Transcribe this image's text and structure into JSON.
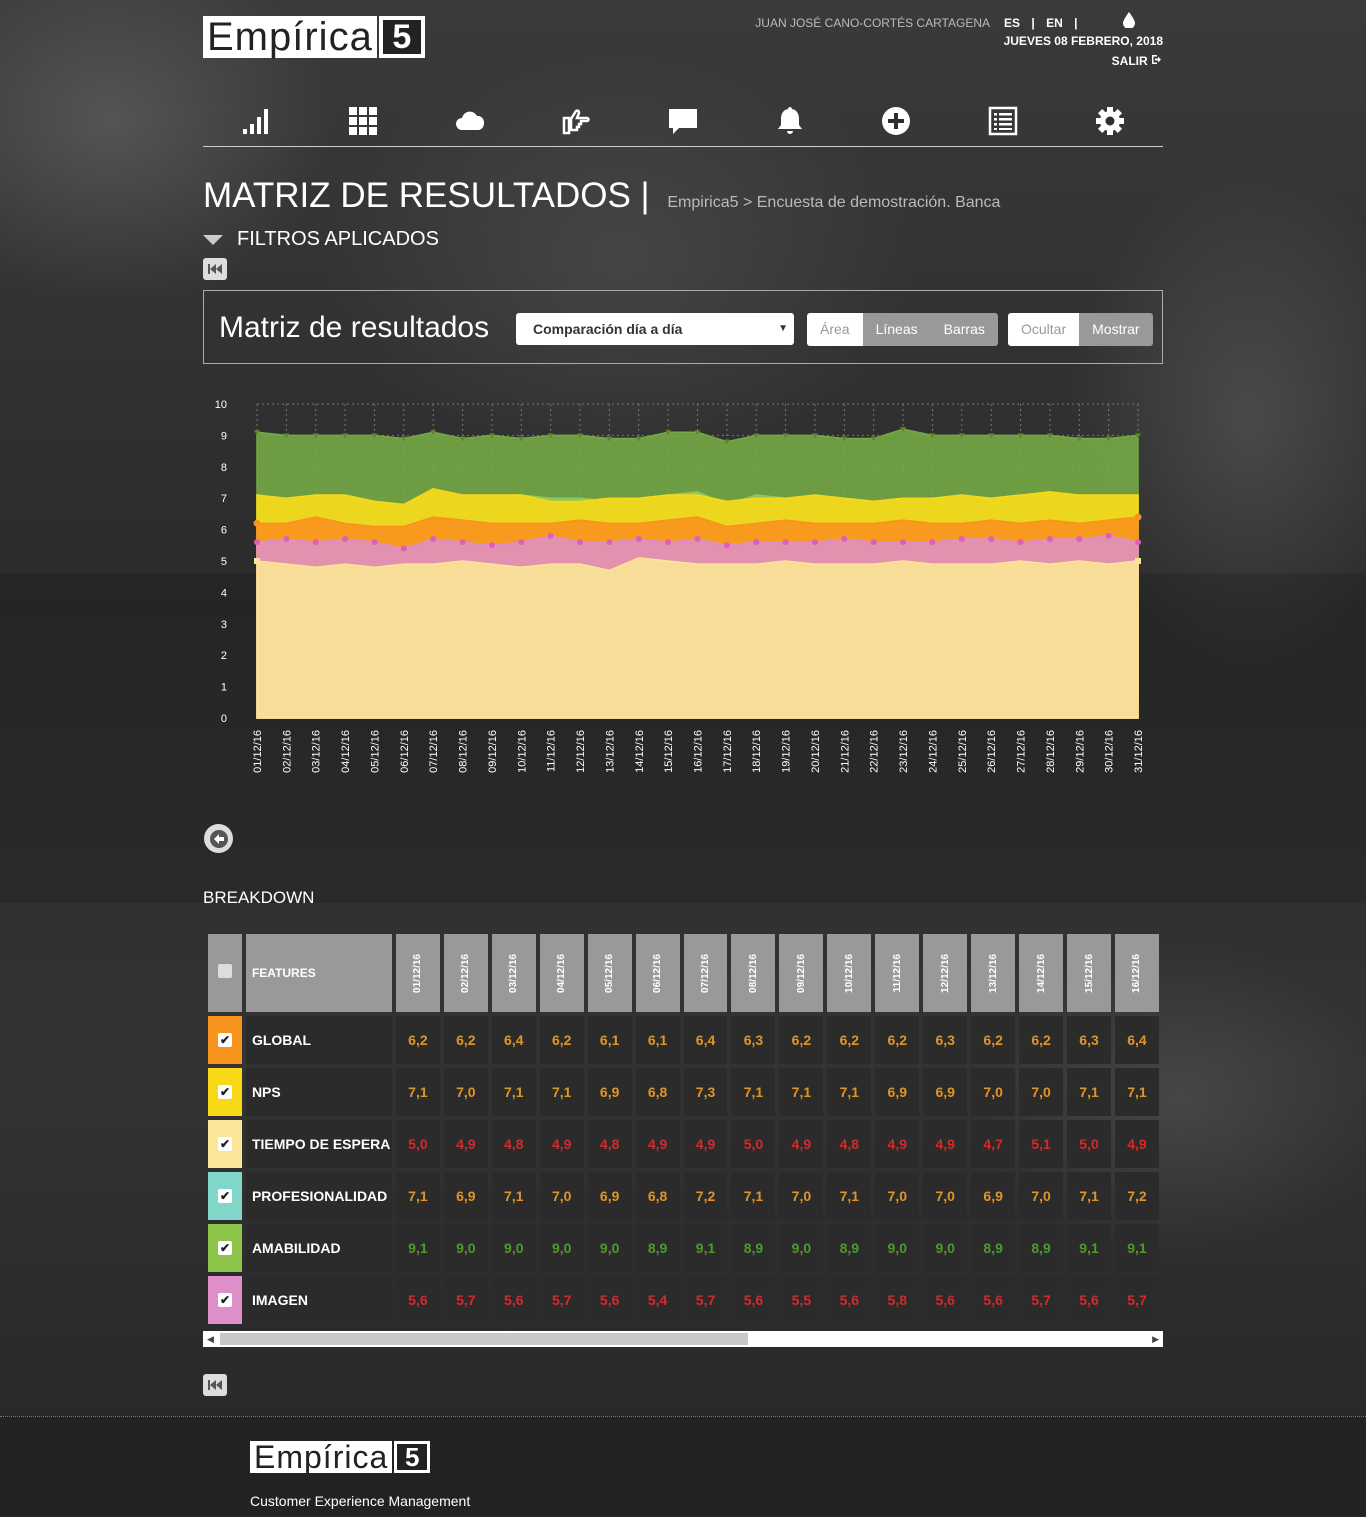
{
  "header": {
    "logo_word": "Empírica",
    "logo_num": "5",
    "user": "JUAN JOSÉ CANO-CORTÉS CARTAGENA",
    "lang_es": "ES",
    "lang_sep": "|",
    "lang_en": "EN",
    "date": "JUEVES 08 FEBRERO, 2018",
    "logout": "SALIR"
  },
  "nav_icons": [
    "bar-chart-icon",
    "grid-icon",
    "cloud-icon",
    "hand-pointer-icon",
    "comment-icon",
    "bell-icon",
    "plus-circle-icon",
    "list-icon",
    "gear-icon"
  ],
  "page": {
    "title": "MATRIZ DE RESULTADOS |",
    "breadcrumb": "Empirica5 > Encuesta de demostración. Banca",
    "filters": "FILTROS APLICADOS"
  },
  "panel": {
    "title": "Matriz de resultados",
    "select_value": "Comparación día a día",
    "type_buttons": [
      "Área",
      "Líneas",
      "Barras"
    ],
    "active_type": "Área",
    "visibility_buttons": [
      "Ocultar",
      "Mostrar"
    ],
    "active_visibility": "Ocultar"
  },
  "chart_data": {
    "type": "area",
    "title": "",
    "xlabel": "",
    "ylabel": "",
    "ylim": [
      0,
      10
    ],
    "yticks": [
      0,
      1,
      2,
      3,
      4,
      5,
      6,
      7,
      8,
      9,
      10
    ],
    "x": [
      "01/12/16",
      "02/12/16",
      "03/12/16",
      "04/12/16",
      "05/12/16",
      "06/12/16",
      "07/12/16",
      "08/12/16",
      "09/12/16",
      "10/12/16",
      "11/12/16",
      "12/12/16",
      "13/12/16",
      "14/12/16",
      "15/12/16",
      "16/12/16",
      "17/12/16",
      "18/12/16",
      "19/12/16",
      "20/12/16",
      "21/12/16",
      "22/12/16",
      "23/12/16",
      "24/12/16",
      "25/12/16",
      "26/12/16",
      "27/12/16",
      "28/12/16",
      "29/12/16",
      "30/12/16",
      "31/12/16"
    ],
    "grid": true,
    "legend": "none",
    "series": [
      {
        "color": "#76a846",
        "values": [
          9.1,
          9.0,
          9.0,
          9.0,
          9.0,
          8.9,
          9.1,
          8.9,
          9.0,
          8.9,
          9.0,
          9.0,
          8.9,
          8.9,
          9.1,
          9.1,
          8.8,
          9.0,
          9.0,
          9.0,
          8.9,
          8.9,
          9.2,
          9.0,
          9.0,
          9.0,
          9.0,
          9.0,
          8.9,
          8.9,
          9.0
        ]
      },
      {
        "color": "#8dc965",
        "values": [
          7.1,
          6.9,
          7.1,
          7.0,
          6.9,
          6.8,
          7.2,
          7.1,
          7.0,
          7.1,
          7.0,
          7.0,
          6.9,
          7.0,
          7.1,
          7.2,
          6.8,
          7.1,
          7.0,
          7.0,
          7.0,
          6.9,
          7.0,
          7.0,
          7.0,
          7.0,
          7.1,
          7.2,
          7.0,
          7.0,
          7.1
        ]
      },
      {
        "color": "#f7d917",
        "values": [
          7.1,
          7.0,
          7.1,
          7.1,
          6.9,
          6.8,
          7.3,
          7.1,
          7.1,
          7.1,
          6.9,
          6.9,
          7.0,
          7.0,
          7.1,
          7.1,
          6.9,
          7.0,
          7.0,
          7.1,
          7.0,
          6.9,
          7.0,
          7.0,
          7.1,
          7.0,
          7.1,
          7.2,
          7.1,
          7.1,
          7.1
        ]
      },
      {
        "color": "#f7941d",
        "values": [
          6.2,
          6.2,
          6.4,
          6.2,
          6.1,
          6.1,
          6.4,
          6.3,
          6.2,
          6.2,
          6.2,
          6.3,
          6.2,
          6.2,
          6.3,
          6.4,
          6.1,
          6.2,
          6.3,
          6.2,
          6.2,
          6.2,
          6.3,
          6.2,
          6.2,
          6.3,
          6.2,
          6.3,
          6.2,
          6.3,
          6.4
        ]
      },
      {
        "color": "#de8fc9",
        "values": [
          5.6,
          5.7,
          5.6,
          5.7,
          5.6,
          5.4,
          5.7,
          5.6,
          5.5,
          5.6,
          5.8,
          5.6,
          5.6,
          5.7,
          5.6,
          5.7,
          5.5,
          5.6,
          5.6,
          5.6,
          5.7,
          5.6,
          5.6,
          5.6,
          5.7,
          5.7,
          5.6,
          5.7,
          5.7,
          5.8,
          5.6
        ]
      },
      {
        "color": "#fbe697",
        "values": [
          5.0,
          4.9,
          4.8,
          4.9,
          4.8,
          4.9,
          4.9,
          5.0,
          4.9,
          4.8,
          4.9,
          4.9,
          4.7,
          5.1,
          5.0,
          4.9,
          4.9,
          4.9,
          5.0,
          4.9,
          4.9,
          4.9,
          5.0,
          4.9,
          4.9,
          4.9,
          5.0,
          4.9,
          5.0,
          4.9,
          5.0
        ]
      }
    ]
  },
  "breakdown": {
    "title": "BREAKDOWN",
    "features_header": "FEATURES",
    "dates": [
      "01/12/16",
      "02/12/16",
      "03/12/16",
      "04/12/16",
      "05/12/16",
      "06/12/16",
      "07/12/16",
      "08/12/16",
      "09/12/16",
      "10/12/16",
      "11/12/16",
      "12/12/16",
      "13/12/16",
      "14/12/16",
      "15/12/16",
      "16/12/16"
    ],
    "rows": [
      {
        "name": "GLOBAL",
        "swatch": "#f7941d",
        "value_color": "#e0952a",
        "values": [
          "6,2",
          "6,2",
          "6,4",
          "6,2",
          "6,1",
          "6,1",
          "6,4",
          "6,3",
          "6,2",
          "6,2",
          "6,2",
          "6,3",
          "6,2",
          "6,2",
          "6,3",
          "6,4"
        ]
      },
      {
        "name": "NPS",
        "swatch": "#f7d917",
        "value_color": "#e0952a",
        "values": [
          "7,1",
          "7,0",
          "7,1",
          "7,1",
          "6,9",
          "6,8",
          "7,3",
          "7,1",
          "7,1",
          "7,1",
          "6,9",
          "6,9",
          "7,0",
          "7,0",
          "7,1",
          "7,1"
        ]
      },
      {
        "name": "TIEMPO DE ESPERA",
        "swatch": "#fbe697",
        "value_color": "#d42a2a",
        "values": [
          "5,0",
          "4,9",
          "4,8",
          "4,9",
          "4,8",
          "4,9",
          "4,9",
          "5,0",
          "4,9",
          "4,8",
          "4,9",
          "4,9",
          "4,7",
          "5,1",
          "5,0",
          "4,9"
        ]
      },
      {
        "name": "PROFESIONALIDAD",
        "swatch": "#7fd6c9",
        "value_color": "#e0952a",
        "values": [
          "7,1",
          "6,9",
          "7,1",
          "7,0",
          "6,9",
          "6,8",
          "7,2",
          "7,1",
          "7,0",
          "7,1",
          "7,0",
          "7,0",
          "6,9",
          "7,0",
          "7,1",
          "7,2"
        ]
      },
      {
        "name": "AMABILIDAD",
        "swatch": "#8dc54b",
        "value_color": "#4e9a2f",
        "values": [
          "9,1",
          "9,0",
          "9,0",
          "9,0",
          "9,0",
          "8,9",
          "9,1",
          "8,9",
          "9,0",
          "8,9",
          "9,0",
          "9,0",
          "8,9",
          "8,9",
          "9,1",
          "9,1"
        ]
      },
      {
        "name": "IMAGEN",
        "swatch": "#de8fc9",
        "value_color": "#d42a2a",
        "values": [
          "5,6",
          "5,7",
          "5,6",
          "5,7",
          "5,6",
          "5,4",
          "5,7",
          "5,6",
          "5,5",
          "5,6",
          "5,8",
          "5,6",
          "5,6",
          "5,7",
          "5,6",
          "5,7"
        ]
      }
    ]
  },
  "footer": {
    "logo_word": "Empírica",
    "logo_num": "5",
    "tagline": "Customer Experience Management"
  }
}
